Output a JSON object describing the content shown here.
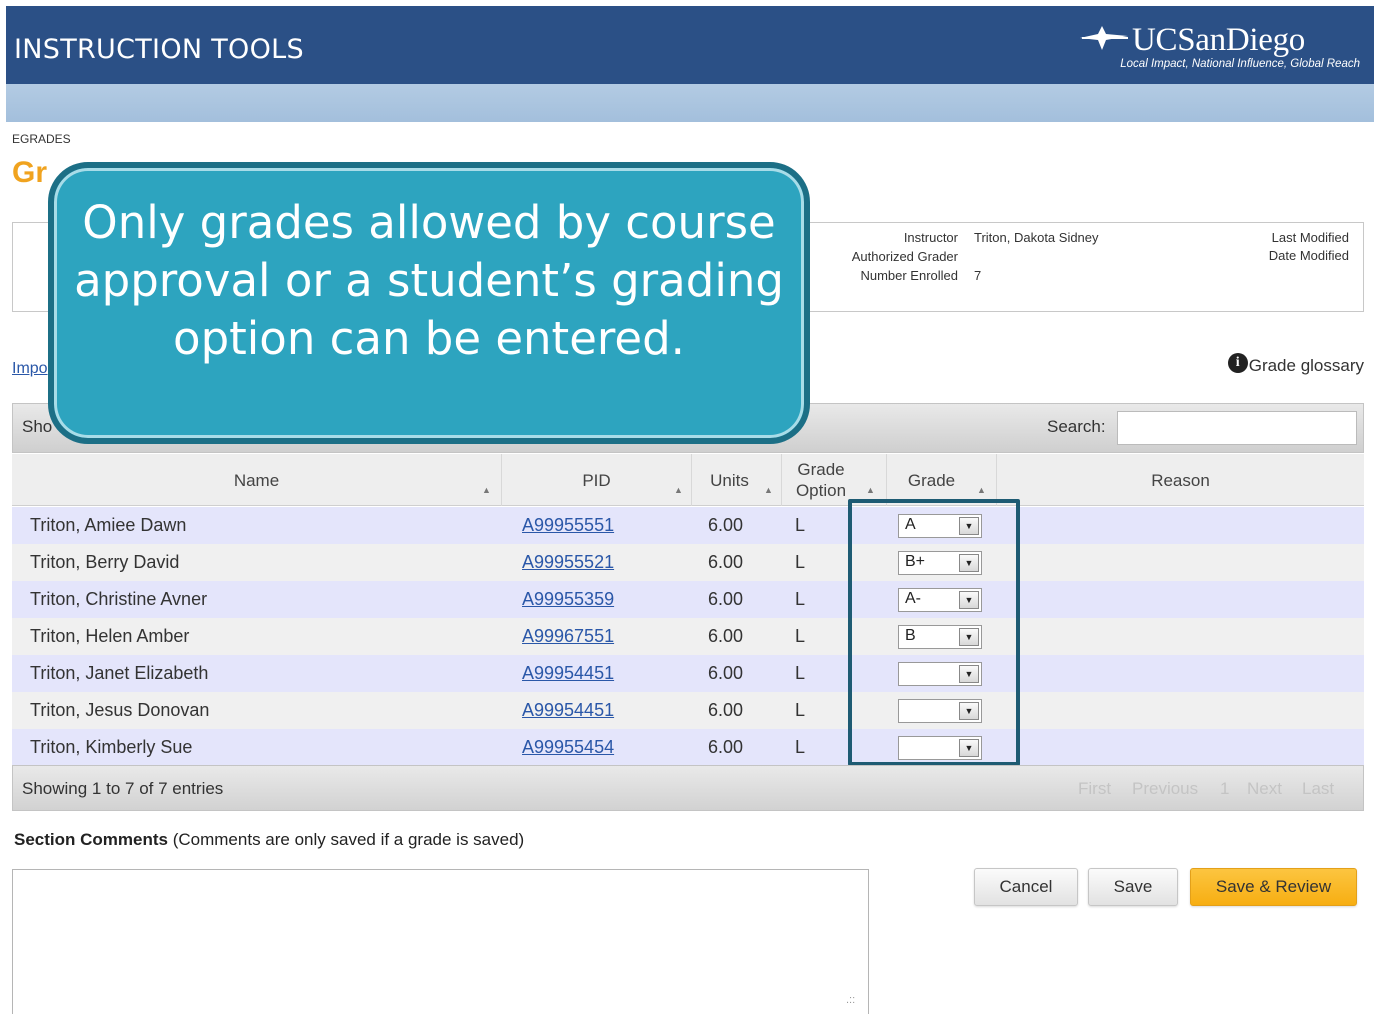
{
  "header": {
    "app_title": "INSTRUCTION TOOLS",
    "logo_name": "UCSanDiego",
    "logo_tagline": "Local Impact, National Influence, Global Reach"
  },
  "breadcrumb": "EGRADES",
  "page_title": "Gr",
  "info": {
    "instructor_label": "Instructor",
    "instructor_value": "Triton, Dakota Sidney",
    "authorized_grader_label": "Authorized Grader",
    "number_enrolled_label": "Number Enrolled",
    "number_enrolled_value": "7",
    "last_modified_label": "Last Modified",
    "date_modified_label": "Date Modified"
  },
  "import_link": "Impo",
  "grade_glossary": "Grade glossary",
  "toolbar": {
    "show_label": "Sho",
    "search_label": "Search:",
    "search_value": ""
  },
  "table": {
    "headers": {
      "name": "Name",
      "pid": "PID",
      "units": "Units",
      "grade_option_1": "Grade",
      "grade_option_2": "Option",
      "grade": "Grade",
      "reason": "Reason"
    },
    "rows": [
      {
        "name": "Triton, Amiee Dawn",
        "pid": "A99955551",
        "units": "6.00",
        "option": "L",
        "grade": "A"
      },
      {
        "name": "Triton, Berry David",
        "pid": "A99955521",
        "units": "6.00",
        "option": "L",
        "grade": "B+"
      },
      {
        "name": "Triton, Christine Avner",
        "pid": "A99955359",
        "units": "6.00",
        "option": "L",
        "grade": "A-"
      },
      {
        "name": "Triton, Helen Amber",
        "pid": "A99967551",
        "units": "6.00",
        "option": "L",
        "grade": "B"
      },
      {
        "name": "Triton, Janet Elizabeth",
        "pid": "A99954451",
        "units": "6.00",
        "option": "L",
        "grade": ""
      },
      {
        "name": "Triton, Jesus Donovan",
        "pid": "A99954451",
        "units": "6.00",
        "option": "L",
        "grade": ""
      },
      {
        "name": "Triton, Kimberly Sue",
        "pid": "A99955454",
        "units": "6.00",
        "option": "L",
        "grade": ""
      }
    ]
  },
  "footer": {
    "showing": "Showing 1 to 7 of 7 entries",
    "first": "First",
    "previous": "Previous",
    "page": "1",
    "next": "Next",
    "last": "Last"
  },
  "comments": {
    "label_bold": "Section Comments",
    "label_note": "(Comments are only saved if a grade is saved)",
    "value": ""
  },
  "buttons": {
    "cancel": "Cancel",
    "save": "Save",
    "save_review": "Save & Review"
  },
  "callout": "Only grades allowed by course approval or a student’s grading option can be entered.",
  "colors": {
    "header_bg": "#2b5086",
    "title_orange": "#f0a31f",
    "callout_bg": "#2da4bf",
    "callout_border": "#1c6f86",
    "row_odd": "#e4e5fb",
    "primary_button": "#f7ae12"
  }
}
